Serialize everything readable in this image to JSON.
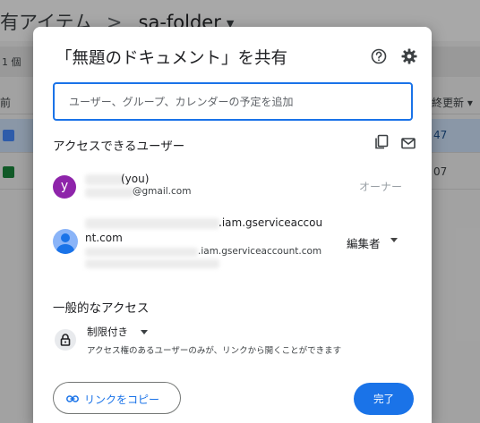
{
  "background": {
    "breadcrumb_root": "有アイテム",
    "breadcrumb_separator": ">",
    "breadcrumb_folder": "sa-folder",
    "selection_count": "1 個",
    "col_name": "前",
    "col_modified": "終更新",
    "rows": [
      {
        "date": "47"
      },
      {
        "date": "07"
      }
    ]
  },
  "dialog": {
    "title": "「無題のドキュメント」を共有",
    "add_placeholder": "ユーザー、グループ、カレンダーの予定を追加",
    "access_section": "アクセスできるユーザー",
    "people": [
      {
        "avatar_letter": "y",
        "name_suffix": "(you)",
        "email_suffix": "@gmail.com",
        "role": "オーナー"
      },
      {
        "name_line1_suffix": ".iam.gserviceaccou",
        "name_line2": "nt.com",
        "email_suffix": ".iam.gserviceaccount.com",
        "role": "編集者"
      }
    ],
    "general_section": "一般的なアクセス",
    "restriction": "制限付き",
    "restriction_desc": "アクセス権のあるユーザーのみが、リンクから開くことができます",
    "copy_link": "リンクをコピー",
    "done": "完了"
  },
  "colors": {
    "accent": "#1a73e8",
    "avatar_purple": "#8e24aa",
    "selected_row": "#c6d8ef"
  }
}
